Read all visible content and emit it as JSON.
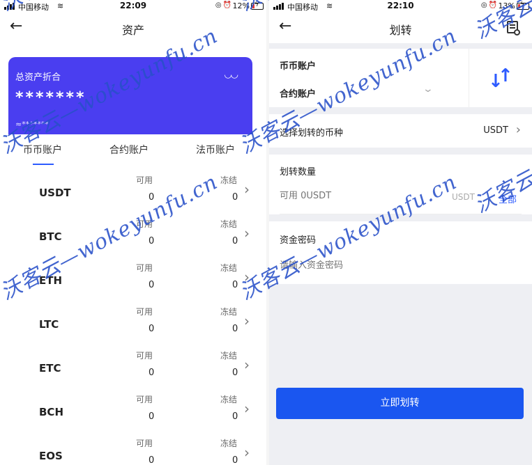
{
  "left": {
    "status": {
      "carrier": "中国移动",
      "time": "22:09",
      "battery": "12%"
    },
    "nav": {
      "title": "资产",
      "back": "←"
    },
    "card": {
      "label": "总资产折合",
      "eye": "◡◡",
      "total": "*******",
      "approx": "≈*******"
    },
    "tabs": [
      "币币账户",
      "合约账户",
      "法币账户"
    ],
    "columns": {
      "available": "可用",
      "frozen": "冻结"
    },
    "coins": [
      {
        "symbol": "USDT",
        "available": "0",
        "frozen": "0"
      },
      {
        "symbol": "BTC",
        "available": "0",
        "frozen": "0"
      },
      {
        "symbol": "ETH",
        "available": "0",
        "frozen": "0"
      },
      {
        "symbol": "LTC",
        "available": "0",
        "frozen": "0"
      },
      {
        "symbol": "ETC",
        "available": "0",
        "frozen": "0"
      },
      {
        "symbol": "BCH",
        "available": "0",
        "frozen": "0"
      },
      {
        "symbol": "EOS",
        "available": "0",
        "frozen": "0"
      }
    ]
  },
  "right": {
    "status": {
      "carrier": "中国移动",
      "time": "22:10",
      "battery": "13%"
    },
    "nav": {
      "title": "划转",
      "back": "←"
    },
    "accounts": {
      "from": "币币账户",
      "to": "合约账户",
      "swap_icon": "swap-arrows-icon"
    },
    "coin_select": {
      "label": "选择划转的币种",
      "value": "USDT"
    },
    "amount": {
      "label": "划转数量",
      "placeholder": "可用 0USDT",
      "unit": "USDT",
      "all": "全部"
    },
    "password": {
      "label": "资金密码",
      "placeholder": "请输入资金密码"
    },
    "submit": "立即划转"
  },
  "watermark": "沃客云—wokeyunfu.cn",
  "colors": {
    "primary": "#1a56f0",
    "card": "#4a3ef0",
    "watermark": "#2850c8"
  }
}
